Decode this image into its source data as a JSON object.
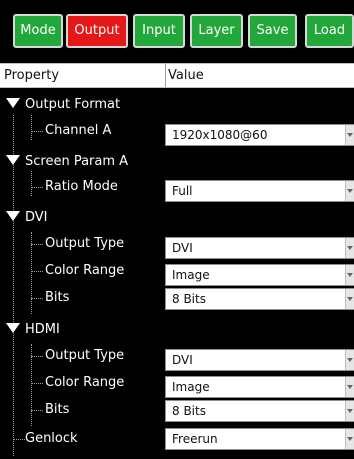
{
  "toolbar": {
    "mode": "Mode",
    "output": "Output",
    "input": "Input",
    "layer": "Layer",
    "save": "Save",
    "load": "Load"
  },
  "header": {
    "property": "Property",
    "value": "Value"
  },
  "output_format": {
    "label": "Output Format",
    "channel_label": "Channel A",
    "channel_value": "1920x1080@60"
  },
  "screen_param": {
    "label": "Screen Param A",
    "ratio_label": "Ratio Mode",
    "ratio_value": "Full"
  },
  "dvi": {
    "label": "DVI",
    "output_type_label": "Output Type",
    "output_type_value": "DVI",
    "color_range_label": "Color Range",
    "color_range_value": "Image",
    "bits_label": "Bits",
    "bits_value": "8 Bits"
  },
  "hdmi": {
    "label": "HDMI",
    "output_type_label": "Output Type",
    "output_type_value": "DVI",
    "color_range_label": "Color Range",
    "color_range_value": "Image",
    "bits_label": "Bits",
    "bits_value": "8 Bits"
  },
  "genlock": {
    "label": "Genlock",
    "value": "Freerun"
  },
  "colors": {
    "button_green": "#22a83a",
    "button_active_red": "#e51717",
    "background": "#000000"
  }
}
